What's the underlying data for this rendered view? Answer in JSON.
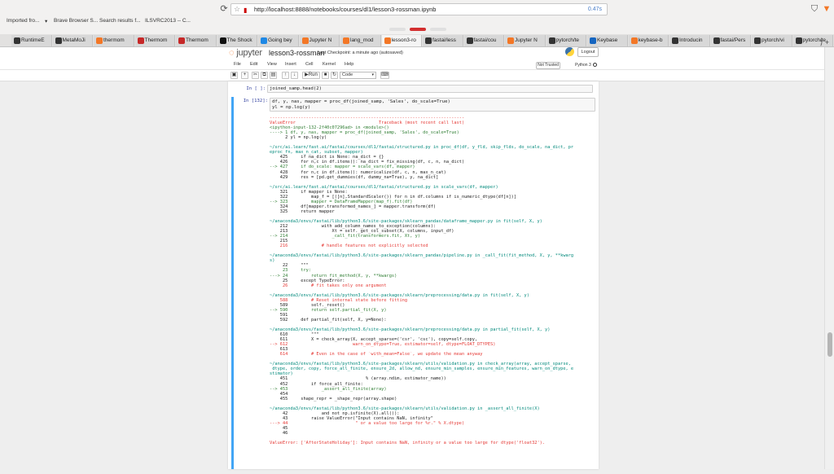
{
  "browser": {
    "url": "http://localhost:8888/notebooks/courses/dl1/lesson3-rossman.ipynb",
    "zoom": "0.47s",
    "bookmarks": [
      "Imported fro...",
      "Brave Browser S...",
      "Search results f...",
      "ILSVRC2013 -- C..."
    ],
    "tabs": [
      "RuntimeE",
      "MetaMoJi",
      "thermom",
      "Thermom",
      "Thermom",
      "The Shock",
      "Going bey",
      "Jupyter N",
      "lang_mod",
      "lesson3-ro",
      "fastai/less",
      "fastai/cou",
      "Jupyter N",
      "pytorch/te",
      "Keybase",
      "keybase-b",
      "Introducin",
      "fastai/Pers",
      "pytorch/vi",
      "pytorch/te"
    ],
    "active_tab_index": 9,
    "accent": "#f37726"
  },
  "jupyter": {
    "logo": "jupyter",
    "notebook_title": "lesson3-rossman",
    "checkpoint": "Last Checkpoint: a minute ago  (autosaved)",
    "logout_label": "Logout",
    "menus": [
      "File",
      "Edit",
      "View",
      "Insert",
      "Cell",
      "Kernel",
      "Help"
    ],
    "trusted_label": "Not Trusted",
    "kernel_label": "Python 3",
    "toolbar": {
      "run_label": "Run",
      "cell_type": "Code"
    }
  },
  "cells": [
    {
      "prompt": "In [ ]:",
      "code": "joined_samp.head(2)"
    },
    {
      "prompt": "In [132]:",
      "code_line1": "df, y, nas, mapper = proc_df(joined_samp, 'Sales', do_scale=True)",
      "code_line2": "yl = np.log(y)"
    }
  ],
  "traceback": [
    {
      "t": "---------------------------------------------------------------------------",
      "c": "c-red"
    },
    {
      "t": "ValueError                                Traceback (most recent call last)",
      "c": "c-red"
    },
    {
      "t": "<ipython-input-132-2f40c07296ad> in <module>()",
      "c": "c-green"
    },
    {
      "t": "----> 1 df, y, nas, mapper = proc_df(joined_samp, 'Sales', do_scale=True)",
      "c": "c-green"
    },
    {
      "t": "      2 yl = np.log(y)",
      "c": ""
    },
    {
      "t": "",
      "c": ""
    },
    {
      "t": "~/src/ai.learn/fast.ai/fastai/courses/dl1/fastai/structured.py in proc_df(df, y_fld, skip_flds, do_scale, na_dict, pr",
      "c": "c-teal"
    },
    {
      "t": "eproc_fn, max_n_cat, subset, mapper)",
      "c": "c-teal"
    },
    {
      "t": "    425     if na_dict is None: na_dict = {}",
      "c": ""
    },
    {
      "t": "    426     for n,c in df.items(): na_dict = fix_missing(df, c, n, na_dict)",
      "c": ""
    },
    {
      "t": "--> 427     if do_scale: mapper = scale_vars(df, mapper)",
      "c": "c-green"
    },
    {
      "t": "    428     for n,c in df.items(): numericalize(df, c, n, max_n_cat)",
      "c": ""
    },
    {
      "t": "    429     res = [pd.get_dummies(df, dummy_na=True), y, na_dict]",
      "c": ""
    },
    {
      "t": "",
      "c": ""
    },
    {
      "t": "~/src/ai.learn/fast.ai/fastai/courses/dl1/fastai/structured.py in scale_vars(df, mapper)",
      "c": "c-teal"
    },
    {
      "t": "    321     if mapper is None:",
      "c": ""
    },
    {
      "t": "    322         map_f = [([n],StandardScaler()) for n in df.columns if is_numeric_dtype(df[n])]",
      "c": ""
    },
    {
      "t": "--> 323         mapper = DataFrameMapper(map_f).fit(df)",
      "c": "c-green"
    },
    {
      "t": "    324     df[mapper.transformed_names_] = mapper.transform(df)",
      "c": ""
    },
    {
      "t": "    325     return mapper",
      "c": ""
    },
    {
      "t": "",
      "c": ""
    },
    {
      "t": "~/anaconda3/envs/fastai/lib/python3.6/site-packages/sklearn_pandas/dataframe_mapper.py in fit(self, X, y)",
      "c": "c-teal"
    },
    {
      "t": "    212             with add_column_names_to_exception(columns):",
      "c": ""
    },
    {
      "t": "    213                 Xt = self._get_col_subset(X, columns, input_df)",
      "c": ""
    },
    {
      "t": "--> 214                 _call_fit(transformers.fit, Xt, y)",
      "c": "c-green"
    },
    {
      "t": "    215 ",
      "c": ""
    },
    {
      "t": "    216             # handle features not explicitly selected",
      "c": "c-red"
    },
    {
      "t": "",
      "c": ""
    },
    {
      "t": "~/anaconda3/envs/fastai/lib/python3.6/site-packages/sklearn_pandas/pipeline.py in _call_fit(fit_method, X, y, **kwarg",
      "c": "c-teal"
    },
    {
      "t": "s)",
      "c": "c-teal"
    },
    {
      "t": "     22     \"\"\"",
      "c": ""
    },
    {
      "t": "     23     try:",
      "c": "c-green"
    },
    {
      "t": "---> 24         return fit_method(X, y, **kwargs)",
      "c": "c-green"
    },
    {
      "t": "     25     except TypeError:",
      "c": ""
    },
    {
      "t": "     26         # fit takes only one argument",
      "c": "c-red"
    },
    {
      "t": "",
      "c": ""
    },
    {
      "t": "~/anaconda3/envs/fastai/lib/python3.6/site-packages/sklearn/preprocessing/data.py in fit(self, X, y)",
      "c": "c-teal"
    },
    {
      "t": "    588         # Reset internal state before fitting",
      "c": "c-red"
    },
    {
      "t": "    589         self._reset()",
      "c": ""
    },
    {
      "t": "--> 590         return self.partial_fit(X, y)",
      "c": "c-green"
    },
    {
      "t": "    591 ",
      "c": ""
    },
    {
      "t": "    592     def partial_fit(self, X, y=None):",
      "c": ""
    },
    {
      "t": "",
      "c": ""
    },
    {
      "t": "~/anaconda3/envs/fastai/lib/python3.6/site-packages/sklearn/preprocessing/data.py in partial_fit(self, X, y)",
      "c": "c-teal"
    },
    {
      "t": "    610         \"\"\"",
      "c": ""
    },
    {
      "t": "    611         X = check_array(X, accept_sparse=('csr', 'csc'), copy=self.copy,",
      "c": ""
    },
    {
      "t": "--> 612                         warn_on_dtype=True, estimator=self, dtype=FLOAT_DTYPES)",
      "c": "c-red"
    },
    {
      "t": "    613 ",
      "c": ""
    },
    {
      "t": "    614         # Even in the case of `with_mean=False`, we update the mean anyway",
      "c": "c-red"
    },
    {
      "t": "",
      "c": ""
    },
    {
      "t": "~/anaconda3/envs/fastai/lib/python3.6/site-packages/sklearn/utils/validation.py in check_array(array, accept_sparse,",
      "c": "c-teal"
    },
    {
      "t": " dtype, order, copy, force_all_finite, ensure_2d, allow_nd, ensure_min_samples, ensure_min_features, warn_on_dtype, e",
      "c": "c-teal"
    },
    {
      "t": "stimator)",
      "c": "c-teal"
    },
    {
      "t": "    451                              % (array.ndim, estimator_name))",
      "c": ""
    },
    {
      "t": "    452         if force_all_finite:",
      "c": ""
    },
    {
      "t": "--> 453             _assert_all_finite(array)",
      "c": "c-green"
    },
    {
      "t": "    454 ",
      "c": ""
    },
    {
      "t": "    455     shape_repr = _shape_repr(array.shape)",
      "c": ""
    },
    {
      "t": "",
      "c": ""
    },
    {
      "t": "~/anaconda3/envs/fastai/lib/python3.6/site-packages/sklearn/utils/validation.py in _assert_all_finite(X)",
      "c": "c-teal"
    },
    {
      "t": "     42             and not np.isfinite(X).all()):",
      "c": ""
    },
    {
      "t": "     43         raise ValueError(\"Input contains NaN, infinity\"",
      "c": ""
    },
    {
      "t": "---> 44                          \" or a value too large for %r.\" % X.dtype)",
      "c": "c-red"
    },
    {
      "t": "     45 ",
      "c": ""
    },
    {
      "t": "     46 ",
      "c": ""
    },
    {
      "t": "",
      "c": ""
    },
    {
      "t": "ValueError: ['AfterStateHoliday']: Input contains NaN, infinity or a value too large for dtype('float32').",
      "c": "c-red"
    }
  ]
}
